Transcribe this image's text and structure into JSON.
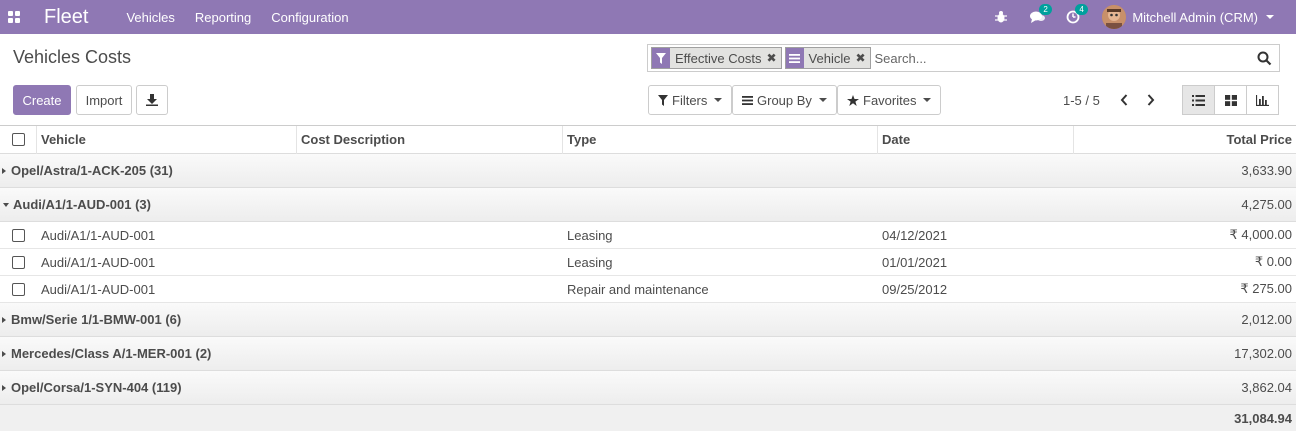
{
  "navbar": {
    "app_name": "Fleet",
    "menu": [
      "Vehicles",
      "Reporting",
      "Configuration"
    ],
    "messages_count": "2",
    "activities_count": "4",
    "user_name": "Mitchell Admin (CRM)",
    "brand_color": "#8f78b4"
  },
  "control_panel": {
    "title": "Vehicles Costs",
    "create_label": "Create",
    "import_label": "Import",
    "search": {
      "facets": [
        {
          "label": "Effective Costs",
          "icon": "filter-icon"
        },
        {
          "label": "Vehicle",
          "icon": "group-by-icon"
        }
      ],
      "placeholder": "Search..."
    },
    "filters_label": "Filters",
    "groupby_label": "Group By",
    "favorites_label": "Favorites",
    "pager": "1-5 / 5"
  },
  "list": {
    "columns": [
      "Vehicle",
      "Cost Description",
      "Type",
      "Date",
      "Total Price"
    ],
    "groups": [
      {
        "label": "Opel/Astra/1-ACK-205 (31)",
        "total": "3,633.90",
        "expanded": false
      },
      {
        "label": "Audi/A1/1-AUD-001 (3)",
        "total": "4,275.00",
        "expanded": true,
        "rows": [
          {
            "vehicle": "Audi/A1/1-AUD-001",
            "description": "",
            "type": "Leasing",
            "date": "04/12/2021",
            "price": "₹ 4,000.00"
          },
          {
            "vehicle": "Audi/A1/1-AUD-001",
            "description": "",
            "type": "Leasing",
            "date": "01/01/2021",
            "price": "₹ 0.00"
          },
          {
            "vehicle": "Audi/A1/1-AUD-001",
            "description": "",
            "type": "Repair and maintenance",
            "date": "09/25/2012",
            "price": "₹ 275.00"
          }
        ]
      },
      {
        "label": "Bmw/Serie 1/1-BMW-001 (6)",
        "total": "2,012.00",
        "expanded": false
      },
      {
        "label": "Mercedes/Class A/1-MER-001 (2)",
        "total": "17,302.00",
        "expanded": false
      },
      {
        "label": "Opel/Corsa/1-SYN-404 (119)",
        "total": "3,862.04",
        "expanded": false
      }
    ],
    "grand_total": "31,084.94"
  }
}
